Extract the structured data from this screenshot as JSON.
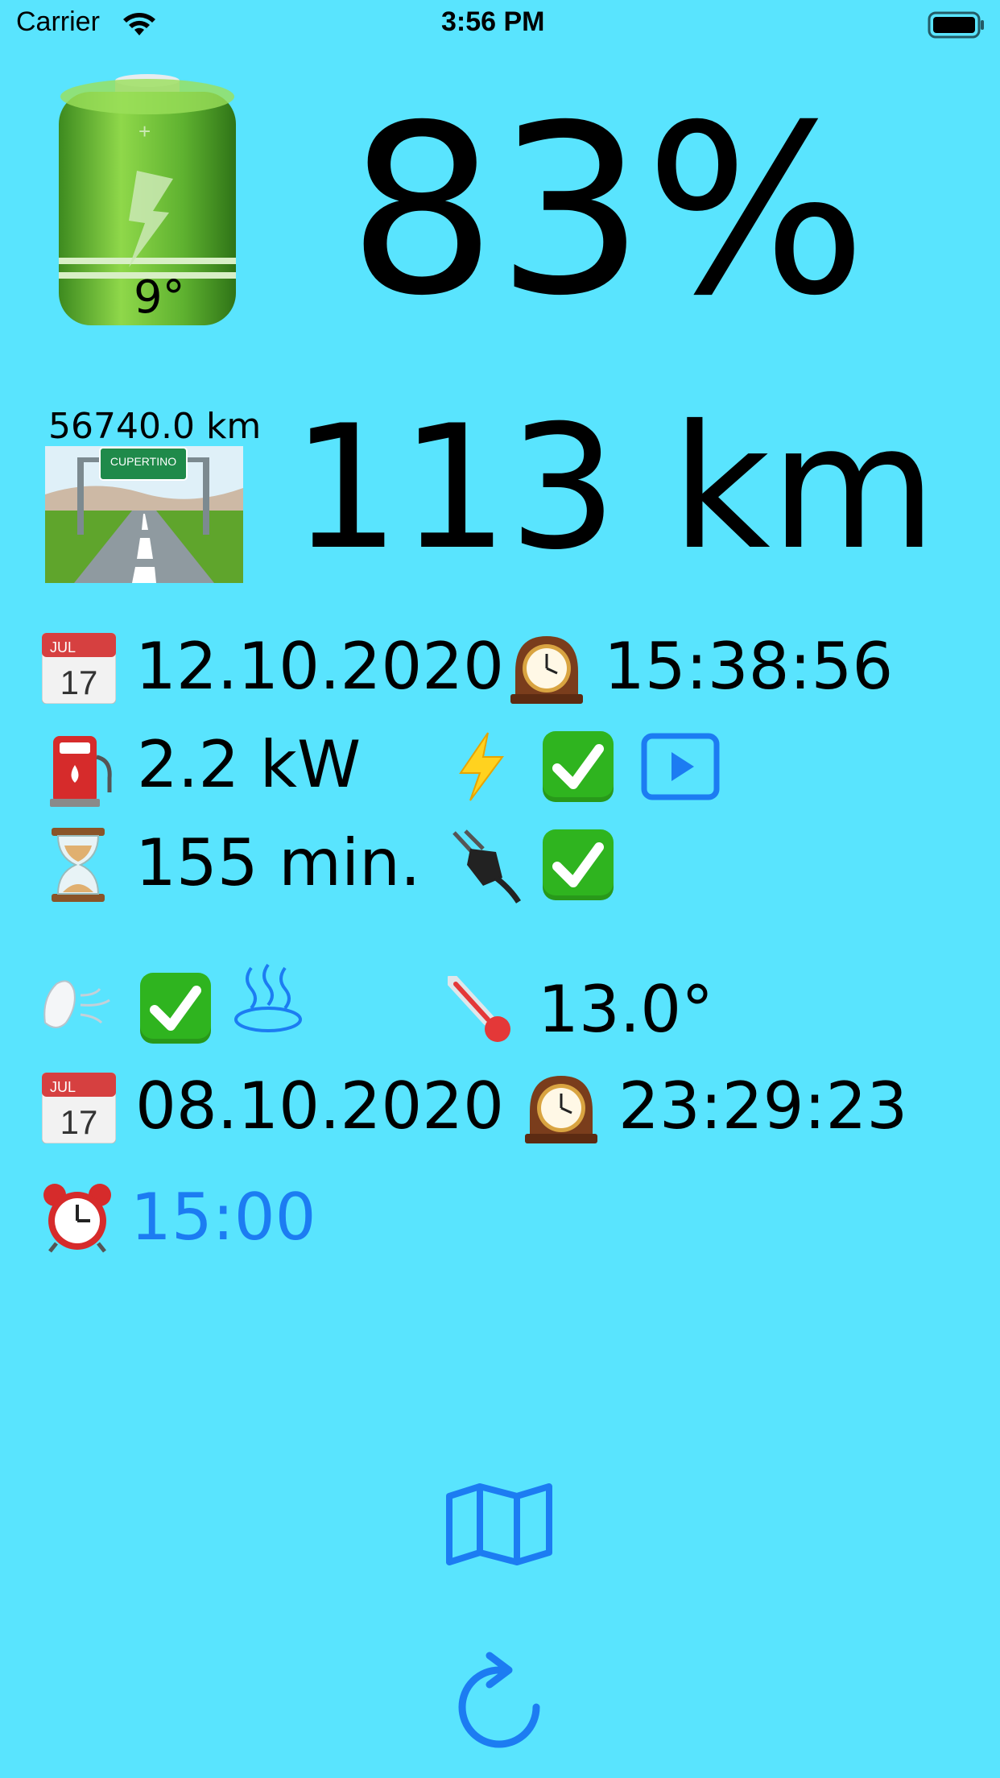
{
  "status_bar": {
    "carrier": "Carrier",
    "time": "3:56 PM"
  },
  "battery": {
    "percent": "83%",
    "temperature": "9°",
    "level": 0.83,
    "color": "#4aa12a"
  },
  "range": {
    "odometer": "56740.0 km",
    "range": "113 km",
    "sign_text": "CUPERTINO"
  },
  "last_update": {
    "date": "12.10.2020",
    "time": "15:38:56"
  },
  "charging": {
    "power": "2.2 kW",
    "remaining": "155 min."
  },
  "climate": {
    "outside_temp": "13.0°"
  },
  "climate_update": {
    "date": "08.10.2020",
    "time": "23:29:23"
  },
  "timer": {
    "time": "15:00"
  },
  "calendar_icon": {
    "month": "JUL",
    "day": "17"
  },
  "colors": {
    "background": "#59e4fe",
    "accent": "#1c7cf2",
    "check": "#2fb41f"
  }
}
